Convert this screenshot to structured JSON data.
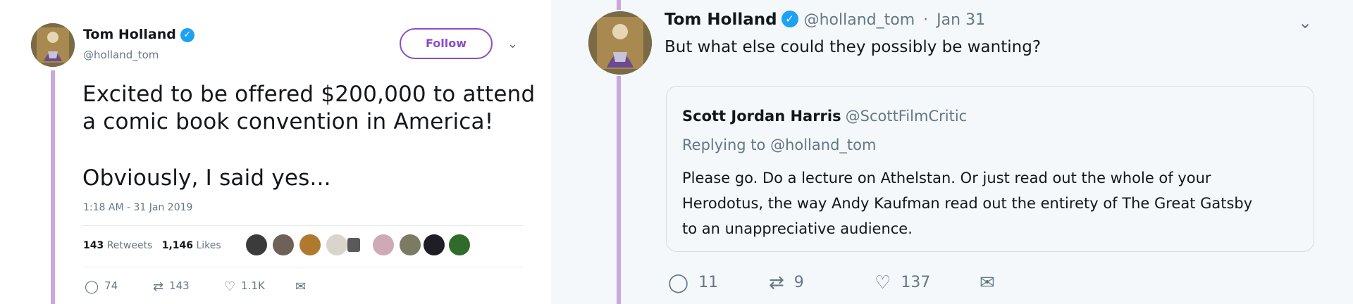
{
  "left_tweet": {
    "author_name": "Tom Holland",
    "handle": "@holland_tom",
    "follow_label": "Follow",
    "caret": "⌄",
    "text_lines": [
      "Excited to be offered $200,000 to attend",
      "a comic book convention in America!",
      "Obviously, I said yes..."
    ],
    "timestamp": "1:18 AM - 31 Jan 2019",
    "retweets_count": "143",
    "retweets_label": "Retweets",
    "likes_count": "1,146",
    "likes_label": "Likes",
    "actions": {
      "replies": "74",
      "retweets": "143",
      "likes": "1.1K"
    }
  },
  "right_tweet": {
    "author_name": "Tom Holland",
    "handle": "@holland_tom",
    "date": "Jan 31",
    "meta_separator": "·",
    "caret": "⌄",
    "text": "But what else could they possibly be wanting?",
    "quoted": {
      "author_name": "Scott Jordan Harris",
      "handle": "@ScottFilmCritic",
      "replying_to": "Replying to @holland_tom",
      "text_lines": [
        "Please go. Do a lecture on Athelstan. Or just read out the whole of your",
        "Herodotus, the way Andy Kaufman read out the entirety of The Great Gatsby",
        "to an unappreciative audience."
      ]
    },
    "actions": {
      "replies": "11",
      "retweets": "9",
      "likes": "137"
    }
  },
  "icons": {
    "verified": "verified-badge-icon",
    "reply": "reply-icon",
    "retweet": "retweet-icon",
    "like": "heart-icon",
    "dm": "direct-message-icon"
  },
  "colors": {
    "accent_purple": "#8b4dc9",
    "thread_line": "#c8a8dd",
    "verified_blue": "#1da1f2",
    "muted_text": "#657786"
  }
}
